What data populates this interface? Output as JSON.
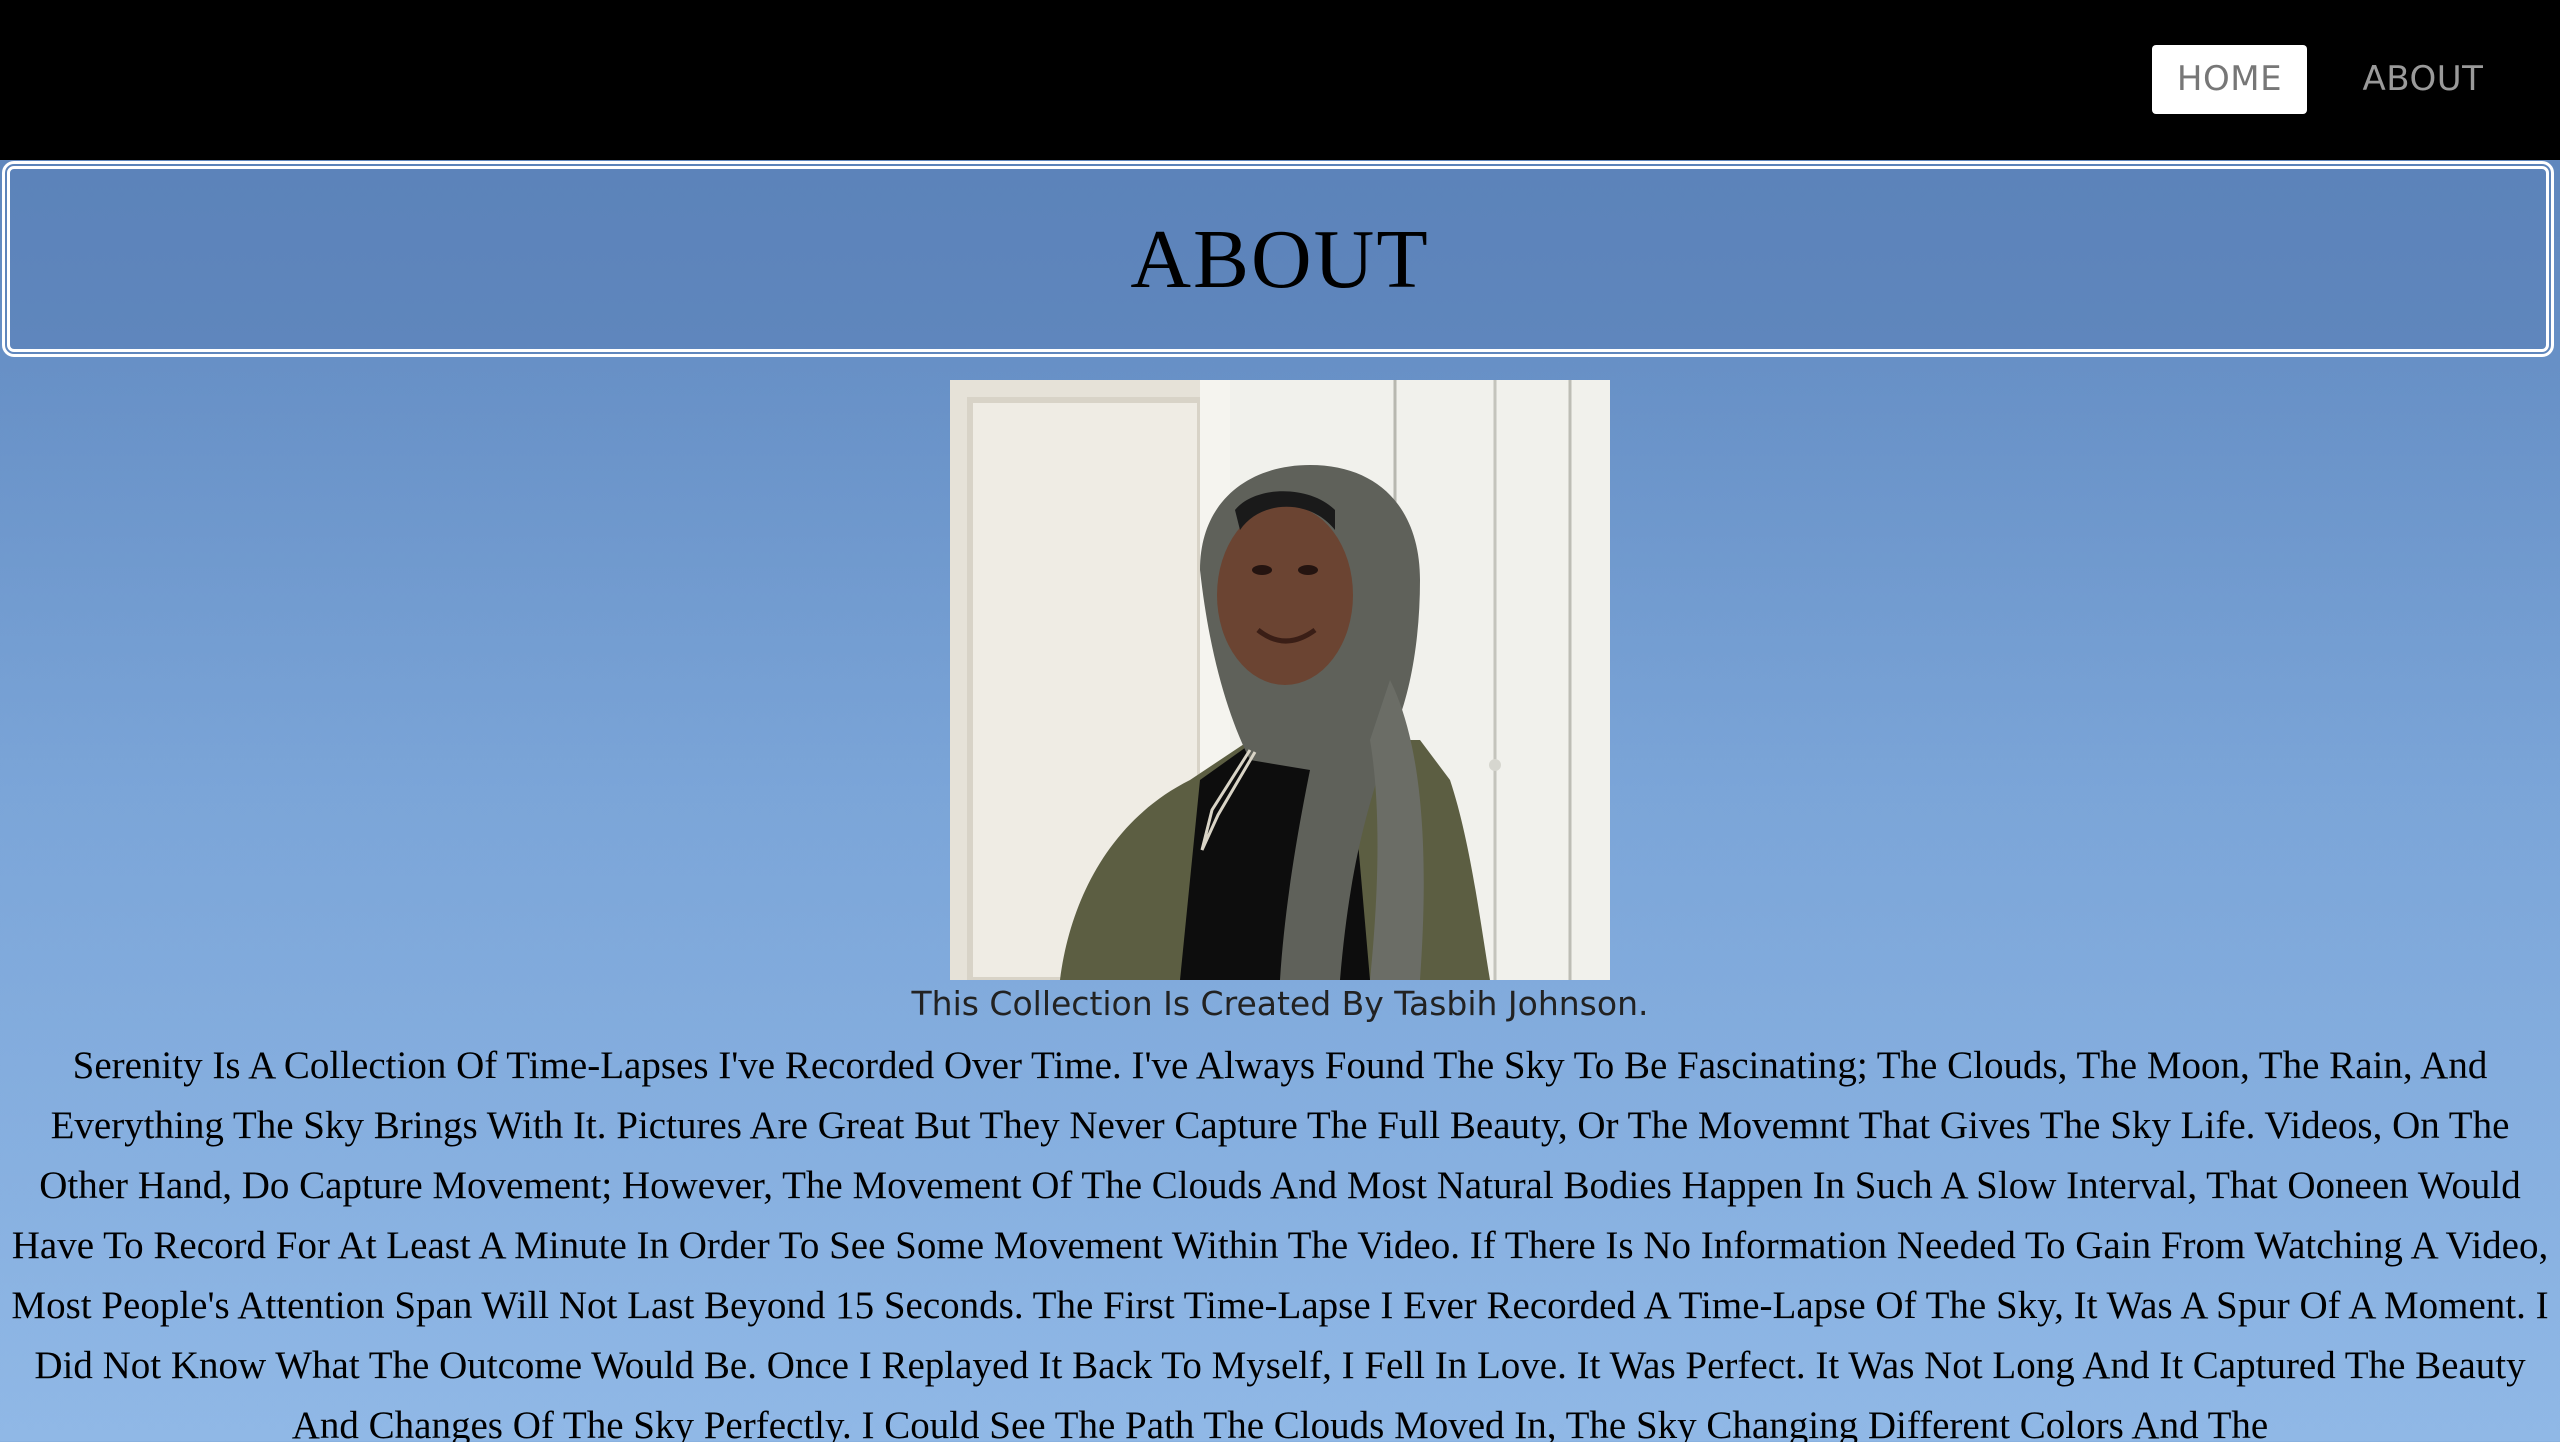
{
  "nav": {
    "home_label": "HOME",
    "about_label": "ABOUT"
  },
  "header": {
    "title": "ABOUT"
  },
  "profile": {
    "caption": "This Collection Is Created By Tasbih Johnson.",
    "photo_icon": "portrait-photo"
  },
  "bio": {
    "text": "Serenity Is A Collection Of Time-Lapses I've Recorded Over Time. I've Always Found The Sky To Be Fascinating; The Clouds, The Moon, The Rain, And Everything The Sky Brings With It. Pictures Are Great But They Never Capture The Full Beauty, Or The Movemnt That Gives The Sky Life. Videos, On The Other Hand, Do Capture Movement; However, The Movement Of The Clouds And Most Natural Bodies Happen In Such A Slow Interval, That Ooneen Would Have To Record For At Least A Minute In Order To See Some Movement Within The Video. If There Is No Information Needed To Gain From Watching A Video, Most People's Attention Span Will Not Last Beyond 15 Seconds. The First Time-Lapse I Ever Recorded A Time-Lapse Of The Sky, It Was A Spur Of A Moment. I Did Not Know What The Outcome Would Be. Once I Replayed It Back To Myself, I Fell In Love. It Was Perfect. It Was Not Long And It Captured The Beauty And Changes Of The Sky Perfectly. I Could See The Path The Clouds Moved In, The Sky Changing Different Colors And The"
  },
  "colors": {
    "navbar_bg": "#000000",
    "sky_top": "#5a80b6",
    "sky_bottom": "#90b8e6",
    "home_button_bg": "#ffffff"
  }
}
